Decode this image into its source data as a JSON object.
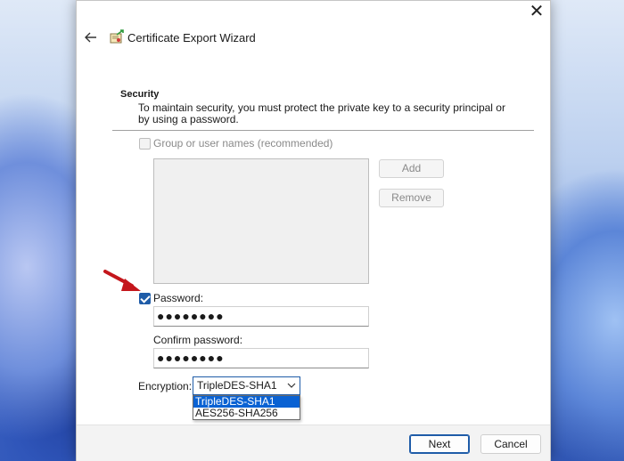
{
  "window": {
    "title": "Certificate Export Wizard",
    "close_glyph": "✕"
  },
  "security": {
    "heading": "Security",
    "description": "To maintain security, you must protect the private key to a security principal or by using a password.",
    "group_checkbox_label": "Group or user names (recommended)",
    "group_checked": false,
    "add_label": "Add",
    "remove_label": "Remove",
    "password_checkbox_label": "Password:",
    "password_checked": true,
    "password_value": "●●●●●●●●",
    "confirm_label": "Confirm password:",
    "confirm_value": "●●●●●●●●",
    "encryption_label": "Encryption:",
    "encryption_selected": "TripleDES-SHA1",
    "encryption_options": [
      "TripleDES-SHA1",
      "AES256-SHA256"
    ]
  },
  "footer": {
    "next_label": "Next",
    "cancel_label": "Cancel"
  },
  "colors": {
    "accent": "#1f5ca8",
    "dropdown_highlight": "#0a62d3",
    "arrow": "#c4161c"
  }
}
